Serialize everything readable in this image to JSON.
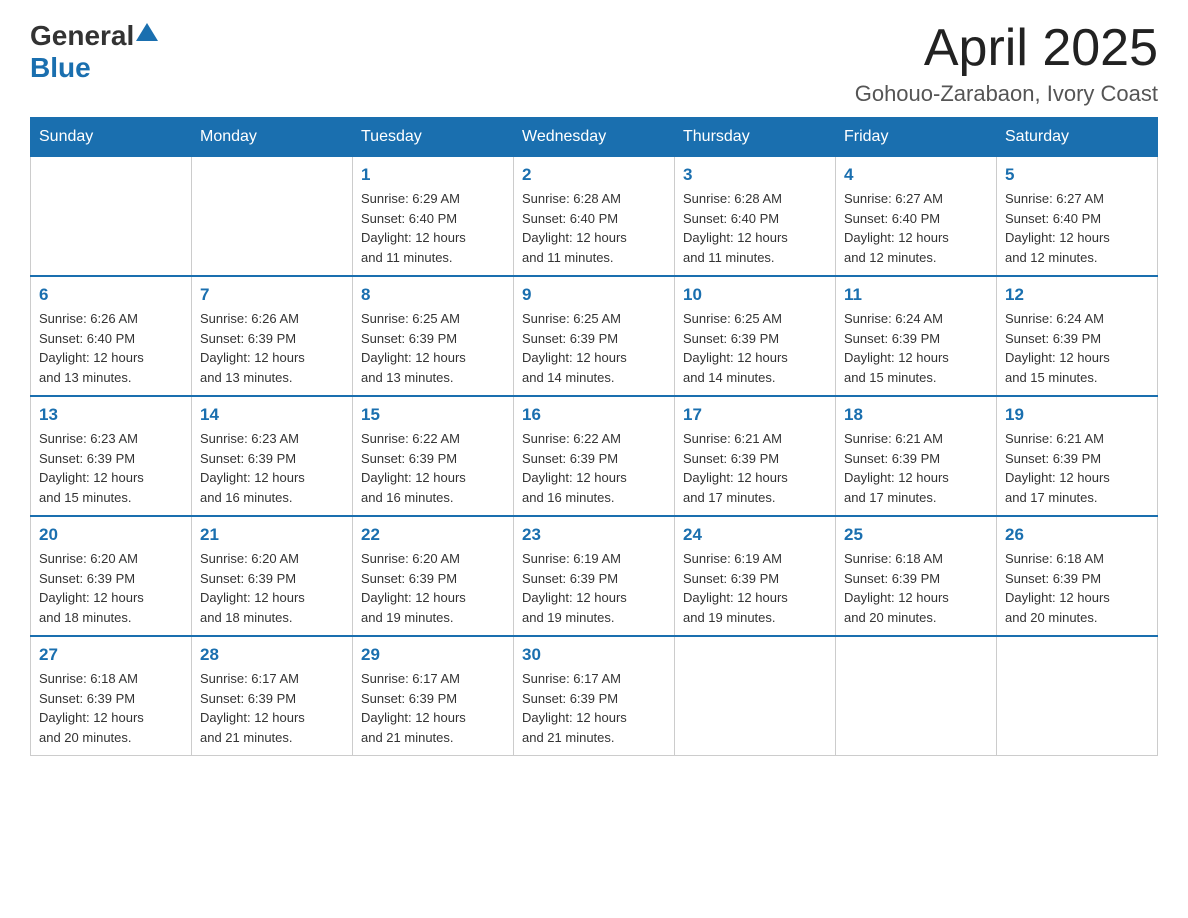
{
  "header": {
    "logo_general": "General",
    "logo_blue": "Blue",
    "month": "April 2025",
    "location": "Gohouo-Zarabaon, Ivory Coast"
  },
  "weekdays": [
    "Sunday",
    "Monday",
    "Tuesday",
    "Wednesday",
    "Thursday",
    "Friday",
    "Saturday"
  ],
  "weeks": [
    [
      {
        "day": "",
        "info": ""
      },
      {
        "day": "",
        "info": ""
      },
      {
        "day": "1",
        "info": "Sunrise: 6:29 AM\nSunset: 6:40 PM\nDaylight: 12 hours\nand 11 minutes."
      },
      {
        "day": "2",
        "info": "Sunrise: 6:28 AM\nSunset: 6:40 PM\nDaylight: 12 hours\nand 11 minutes."
      },
      {
        "day": "3",
        "info": "Sunrise: 6:28 AM\nSunset: 6:40 PM\nDaylight: 12 hours\nand 11 minutes."
      },
      {
        "day": "4",
        "info": "Sunrise: 6:27 AM\nSunset: 6:40 PM\nDaylight: 12 hours\nand 12 minutes."
      },
      {
        "day": "5",
        "info": "Sunrise: 6:27 AM\nSunset: 6:40 PM\nDaylight: 12 hours\nand 12 minutes."
      }
    ],
    [
      {
        "day": "6",
        "info": "Sunrise: 6:26 AM\nSunset: 6:40 PM\nDaylight: 12 hours\nand 13 minutes."
      },
      {
        "day": "7",
        "info": "Sunrise: 6:26 AM\nSunset: 6:39 PM\nDaylight: 12 hours\nand 13 minutes."
      },
      {
        "day": "8",
        "info": "Sunrise: 6:25 AM\nSunset: 6:39 PM\nDaylight: 12 hours\nand 13 minutes."
      },
      {
        "day": "9",
        "info": "Sunrise: 6:25 AM\nSunset: 6:39 PM\nDaylight: 12 hours\nand 14 minutes."
      },
      {
        "day": "10",
        "info": "Sunrise: 6:25 AM\nSunset: 6:39 PM\nDaylight: 12 hours\nand 14 minutes."
      },
      {
        "day": "11",
        "info": "Sunrise: 6:24 AM\nSunset: 6:39 PM\nDaylight: 12 hours\nand 15 minutes."
      },
      {
        "day": "12",
        "info": "Sunrise: 6:24 AM\nSunset: 6:39 PM\nDaylight: 12 hours\nand 15 minutes."
      }
    ],
    [
      {
        "day": "13",
        "info": "Sunrise: 6:23 AM\nSunset: 6:39 PM\nDaylight: 12 hours\nand 15 minutes."
      },
      {
        "day": "14",
        "info": "Sunrise: 6:23 AM\nSunset: 6:39 PM\nDaylight: 12 hours\nand 16 minutes."
      },
      {
        "day": "15",
        "info": "Sunrise: 6:22 AM\nSunset: 6:39 PM\nDaylight: 12 hours\nand 16 minutes."
      },
      {
        "day": "16",
        "info": "Sunrise: 6:22 AM\nSunset: 6:39 PM\nDaylight: 12 hours\nand 16 minutes."
      },
      {
        "day": "17",
        "info": "Sunrise: 6:21 AM\nSunset: 6:39 PM\nDaylight: 12 hours\nand 17 minutes."
      },
      {
        "day": "18",
        "info": "Sunrise: 6:21 AM\nSunset: 6:39 PM\nDaylight: 12 hours\nand 17 minutes."
      },
      {
        "day": "19",
        "info": "Sunrise: 6:21 AM\nSunset: 6:39 PM\nDaylight: 12 hours\nand 17 minutes."
      }
    ],
    [
      {
        "day": "20",
        "info": "Sunrise: 6:20 AM\nSunset: 6:39 PM\nDaylight: 12 hours\nand 18 minutes."
      },
      {
        "day": "21",
        "info": "Sunrise: 6:20 AM\nSunset: 6:39 PM\nDaylight: 12 hours\nand 18 minutes."
      },
      {
        "day": "22",
        "info": "Sunrise: 6:20 AM\nSunset: 6:39 PM\nDaylight: 12 hours\nand 19 minutes."
      },
      {
        "day": "23",
        "info": "Sunrise: 6:19 AM\nSunset: 6:39 PM\nDaylight: 12 hours\nand 19 minutes."
      },
      {
        "day": "24",
        "info": "Sunrise: 6:19 AM\nSunset: 6:39 PM\nDaylight: 12 hours\nand 19 minutes."
      },
      {
        "day": "25",
        "info": "Sunrise: 6:18 AM\nSunset: 6:39 PM\nDaylight: 12 hours\nand 20 minutes."
      },
      {
        "day": "26",
        "info": "Sunrise: 6:18 AM\nSunset: 6:39 PM\nDaylight: 12 hours\nand 20 minutes."
      }
    ],
    [
      {
        "day": "27",
        "info": "Sunrise: 6:18 AM\nSunset: 6:39 PM\nDaylight: 12 hours\nand 20 minutes."
      },
      {
        "day": "28",
        "info": "Sunrise: 6:17 AM\nSunset: 6:39 PM\nDaylight: 12 hours\nand 21 minutes."
      },
      {
        "day": "29",
        "info": "Sunrise: 6:17 AM\nSunset: 6:39 PM\nDaylight: 12 hours\nand 21 minutes."
      },
      {
        "day": "30",
        "info": "Sunrise: 6:17 AM\nSunset: 6:39 PM\nDaylight: 12 hours\nand 21 minutes."
      },
      {
        "day": "",
        "info": ""
      },
      {
        "day": "",
        "info": ""
      },
      {
        "day": "",
        "info": ""
      }
    ]
  ]
}
